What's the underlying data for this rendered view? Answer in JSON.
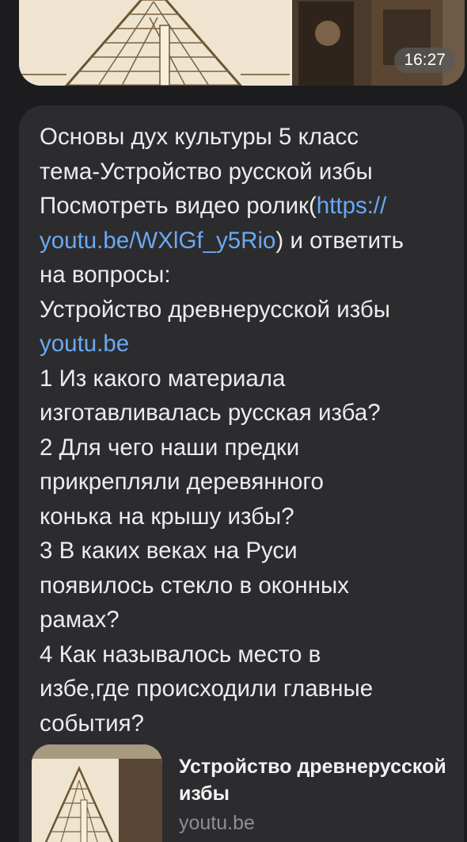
{
  "image_message": {
    "time": "16:27"
  },
  "message": {
    "line1": "Основы дух культуры 5 класс",
    "line2": "тема-Устройство русской избы",
    "line3_prefix": "Посмотреть видео ролик(",
    "link1_part1": "https://",
    "link1_part2": "youtu.be/WXlGf_y5Rio",
    "line4_suffix": ") и ответить",
    "line5": "на вопросы:",
    "line6": "Устройство древнерусской избы",
    "link2": "youtu.be",
    "q1": "1 Из какого материала\nизготавливалась русская изба?",
    "q2": "2 Для чего наши предки\nприкрепляли деревянного\nконька на крышу избы?",
    "q3": "3 В каких веках на Руси\nпоявилось стекло в оконных\nрамах?",
    "q4": "4 Как называлось место в\nизбе,где происходили главные\nсобытия?"
  },
  "link_preview": {
    "title": "Устройство древнерусской избы",
    "domain": "youtu.be"
  },
  "colors": {
    "background": "#1c1c1e",
    "bubble": "#2c2c2e",
    "link": "#6aa9f4",
    "text": "#ececee"
  }
}
